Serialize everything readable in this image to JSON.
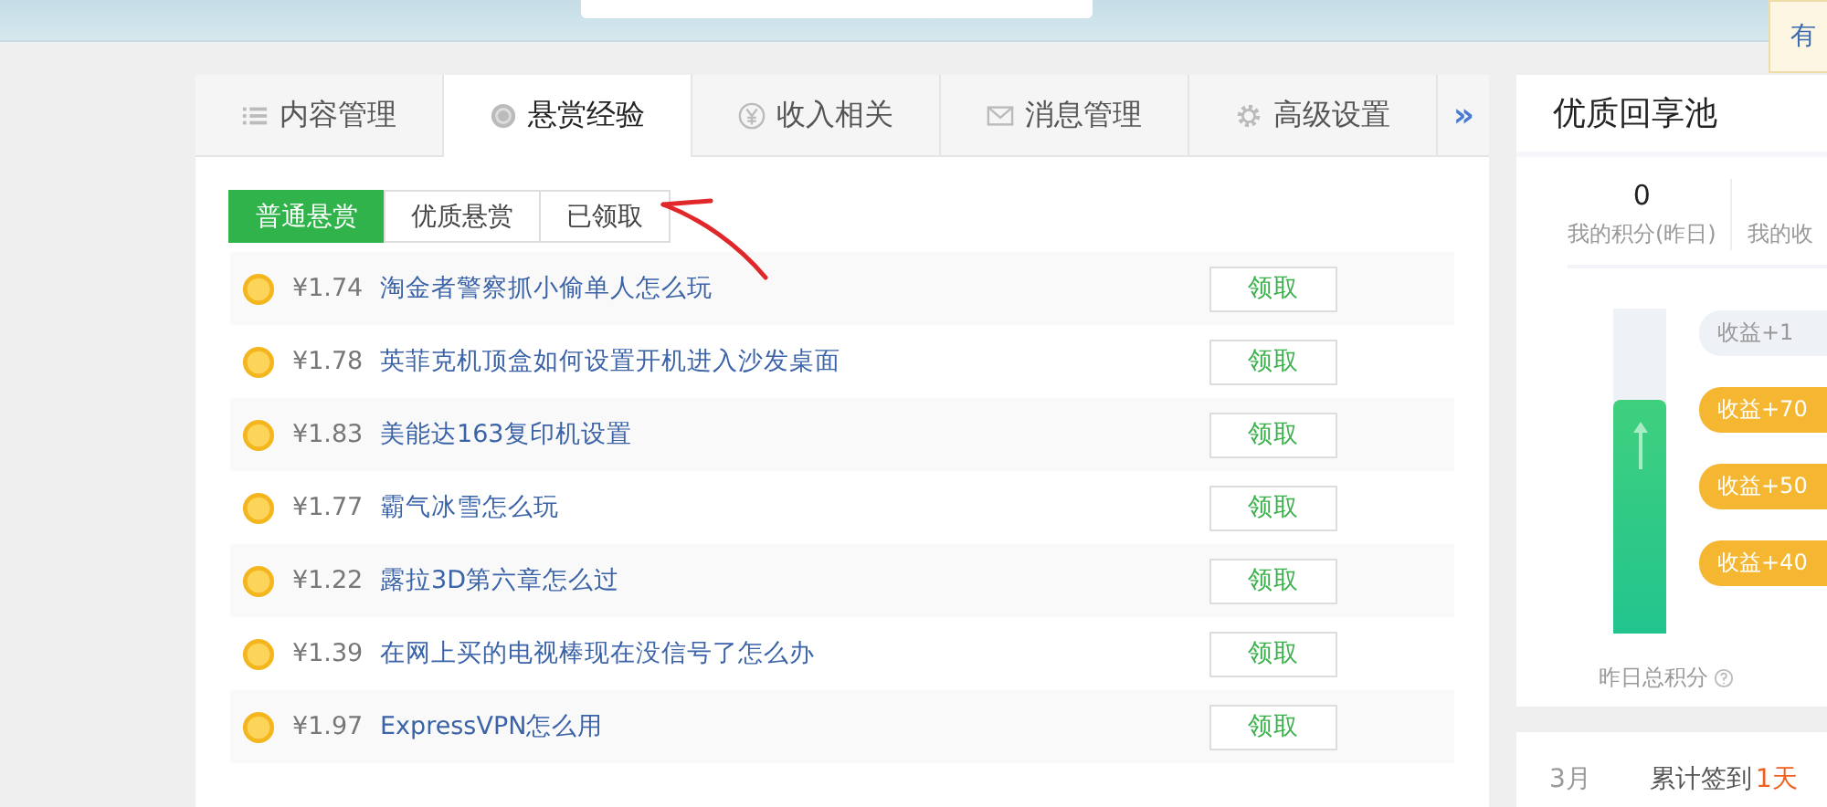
{
  "top_notice": {
    "text": "有"
  },
  "tabs": [
    {
      "label": "内容管理",
      "kind": "list",
      "selected": false
    },
    {
      "label": "悬赏经验",
      "kind": "coin",
      "selected": true
    },
    {
      "label": "收入相关",
      "kind": "yen",
      "selected": false
    },
    {
      "label": "消息管理",
      "kind": "mail",
      "selected": false
    },
    {
      "label": "高级设置",
      "kind": "gear",
      "selected": false
    }
  ],
  "more_tabs": "»",
  "sub_tabs": [
    {
      "label": "普通悬赏",
      "selected": true
    },
    {
      "label": "优质悬赏",
      "selected": false
    },
    {
      "label": "已领取",
      "selected": false
    }
  ],
  "rewards": [
    {
      "amount": "¥1.74",
      "title": "淘金者警察抓小偷单人怎么玩",
      "action": "领取"
    },
    {
      "amount": "¥1.78",
      "title": "英菲克机顶盒如何设置开机进入沙发桌面",
      "action": "领取"
    },
    {
      "amount": "¥1.83",
      "title": "美能达163复印机设置",
      "action": "领取"
    },
    {
      "amount": "¥1.77",
      "title": "霸气冰雪怎么玩",
      "action": "领取"
    },
    {
      "amount": "¥1.22",
      "title": "露拉3D第六章怎么过",
      "action": "领取"
    },
    {
      "amount": "¥1.39",
      "title": "在网上买的电视棒现在没信号了怎么办",
      "action": "领取"
    },
    {
      "amount": "¥1.97",
      "title": "ExpressVPN怎么用",
      "action": "领取"
    }
  ],
  "pool": {
    "title": "优质回享池",
    "stats": [
      {
        "value": "0",
        "label": "我的积分(昨日)"
      },
      {
        "label": "我的收"
      }
    ],
    "tube": {
      "level": 0.72,
      "label": "昨日总积分"
    },
    "tags": [
      {
        "text": "收益+1",
        "kind": "grey"
      },
      {
        "text": "收益+70",
        "kind": "gold"
      },
      {
        "text": "收益+50",
        "kind": "gold"
      },
      {
        "text": "收益+40",
        "kind": "gold"
      }
    ],
    "footer": {
      "month": "3月",
      "checkin_label": "累计签到",
      "checkin_days": "1天"
    }
  }
}
